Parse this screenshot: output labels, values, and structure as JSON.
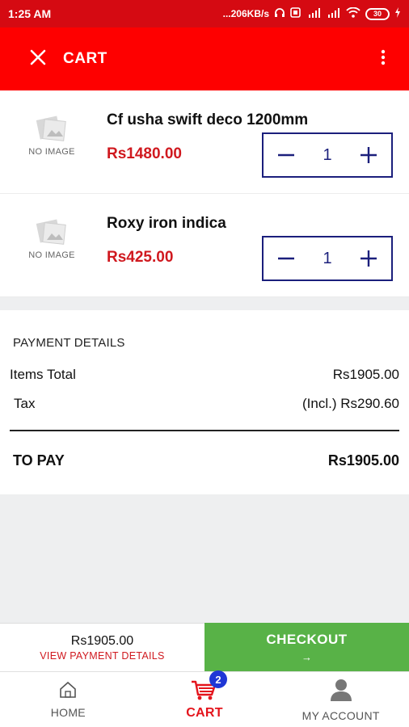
{
  "status_bar": {
    "time": "1:25 AM",
    "speed": "...206KB/s",
    "battery": "30"
  },
  "app_bar": {
    "title": "CART"
  },
  "cart": {
    "items": [
      {
        "name": "Cf usha swift deco 1200mm",
        "price": "Rs1480.00",
        "quantity": "1",
        "image_label": "NO IMAGE"
      },
      {
        "name": "Roxy iron indica",
        "price": "Rs425.00",
        "quantity": "1",
        "image_label": "NO IMAGE"
      }
    ]
  },
  "payment": {
    "heading": "PAYMENT DETAILS",
    "items_total_label": "Items Total",
    "items_total_value": "Rs1905.00",
    "tax_label": "Tax",
    "tax_value": "(Incl.) Rs290.60",
    "to_pay_label": "TO PAY",
    "to_pay_value": "Rs1905.00"
  },
  "bottom_bar": {
    "total": "Rs1905.00",
    "view_details": "VIEW PAYMENT DETAILS",
    "checkout_label": "CHECKOUT",
    "checkout_arrow": "→"
  },
  "nav": {
    "home": "HOME",
    "cart": "CART",
    "cart_badge": "2",
    "account": "MY ACCOUNT"
  },
  "colors": {
    "status_bar": "#d50a12",
    "app_bar": "#fe0000",
    "price": "#d0191f",
    "stepper_border": "#1b1f7c",
    "checkout": "#58b247",
    "badge": "#1f37d6"
  },
  "icons": {
    "close": "close-icon",
    "more": "more-vertical-icon",
    "minus": "minus-icon",
    "plus": "plus-icon",
    "home": "home-icon",
    "cart": "cart-icon",
    "account": "account-icon"
  }
}
